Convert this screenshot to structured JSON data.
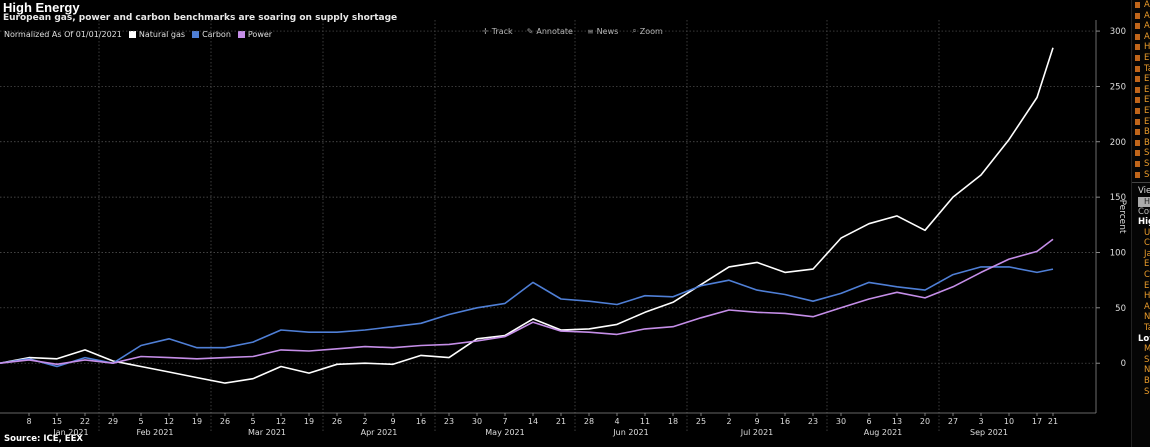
{
  "title": "High Energy",
  "subtitle": "European gas, power and carbon benchmarks are soaring on supply shortage",
  "legend": {
    "caption": "Normalized As Of 01/01/2021",
    "items": [
      {
        "label": "Natural gas",
        "color": "#ffffff"
      },
      {
        "label": "Carbon",
        "color": "#4f7fd6"
      },
      {
        "label": "Power",
        "color": "#c58ee8"
      }
    ]
  },
  "toolbar": [
    {
      "label": "Track",
      "icon": "crosshair-icon"
    },
    {
      "label": "Annotate",
      "icon": "pencil-icon"
    },
    {
      "label": "News",
      "icon": "news-icon"
    },
    {
      "label": "Zoom",
      "icon": "magnifier-icon"
    }
  ],
  "source": "Source: ICE, EEX",
  "side_panel": {
    "top_items": [
      "Ar",
      "Ar",
      "Ar",
      "Ar",
      "Ho",
      "ET",
      "Ta",
      "ET",
      "Ec",
      "ET",
      "ET",
      "ET",
      "Bu",
      "Bu",
      "Se",
      "Se",
      "Se"
    ],
    "view_label": "View",
    "box_label": "Ha",
    "count_label": "Cour",
    "high_label": "High",
    "high_items": [
      "Uni",
      "Chi",
      "Jap",
      "Eu",
      "Can",
      "Eu",
      "Hor",
      "Asi",
      "Nor",
      "Tai"
    ],
    "low_label": "Low",
    "low_items": [
      "Mal",
      "Sou",
      "Nor",
      "Bra",
      "Sou"
    ]
  },
  "chart_data": {
    "type": "line",
    "ylabel": "Percent",
    "ylim": [
      -45,
      310
    ],
    "yticks": [
      0,
      50,
      100,
      150,
      200,
      250,
      300
    ],
    "grid": true,
    "legend_position": "top-left",
    "x_day_labels": [
      "8",
      "15",
      "22",
      "29",
      "5",
      "12",
      "19",
      "26",
      "5",
      "12",
      "19",
      "26",
      "2",
      "9",
      "16",
      "23",
      "30",
      "7",
      "14",
      "21",
      "28",
      "4",
      "11",
      "18",
      "25",
      "2",
      "9",
      "16",
      "23",
      "30",
      "6",
      "13",
      "20",
      "27",
      "3",
      "10",
      "17",
      "21"
    ],
    "month_labels": [
      "Jan 2021",
      "Feb 2021",
      "Mar 2021",
      "Apr 2021",
      "May 2021",
      "Jun 2021",
      "Jul 2021",
      "Aug 2021",
      "Sep 2021"
    ],
    "x": [
      "2021-01-01",
      "2021-01-08",
      "2021-01-15",
      "2021-01-22",
      "2021-01-29",
      "2021-02-05",
      "2021-02-12",
      "2021-02-19",
      "2021-02-26",
      "2021-03-05",
      "2021-03-12",
      "2021-03-19",
      "2021-03-26",
      "2021-04-02",
      "2021-04-09",
      "2021-04-16",
      "2021-04-23",
      "2021-04-30",
      "2021-05-07",
      "2021-05-14",
      "2021-05-21",
      "2021-05-28",
      "2021-06-04",
      "2021-06-11",
      "2021-06-18",
      "2021-06-25",
      "2021-07-02",
      "2021-07-09",
      "2021-07-16",
      "2021-07-23",
      "2021-07-30",
      "2021-08-06",
      "2021-08-13",
      "2021-08-20",
      "2021-08-27",
      "2021-09-03",
      "2021-09-10",
      "2021-09-17",
      "2021-09-21"
    ],
    "series": [
      {
        "name": "Natural gas",
        "color": "#ffffff",
        "values": [
          0,
          5,
          4,
          12,
          2,
          -3,
          -8,
          -13,
          -18,
          -14,
          -3,
          -9,
          -1,
          0,
          -1,
          7,
          5,
          22,
          25,
          40,
          30,
          31,
          35,
          46,
          55,
          71,
          87,
          91,
          82,
          85,
          113,
          126,
          133,
          120,
          150,
          170,
          202,
          240,
          285
        ]
      },
      {
        "name": "Carbon",
        "color": "#4f7fd6",
        "values": [
          0,
          4,
          -3,
          5,
          0,
          16,
          22,
          14,
          14,
          19,
          30,
          28,
          28,
          30,
          33,
          36,
          44,
          50,
          54,
          73,
          58,
          56,
          53,
          61,
          60,
          70,
          75,
          66,
          62,
          56,
          63,
          73,
          69,
          66,
          80,
          87,
          87,
          82,
          85
        ]
      },
      {
        "name": "Power",
        "color": "#c58ee8",
        "values": [
          0,
          3,
          -1,
          3,
          0,
          6,
          5,
          4,
          5,
          6,
          12,
          11,
          13,
          15,
          14,
          16,
          17,
          20,
          24,
          37,
          29,
          28,
          26,
          31,
          33,
          41,
          48,
          46,
          45,
          42,
          50,
          58,
          64,
          59,
          69,
          82,
          94,
          101,
          112
        ]
      }
    ]
  }
}
